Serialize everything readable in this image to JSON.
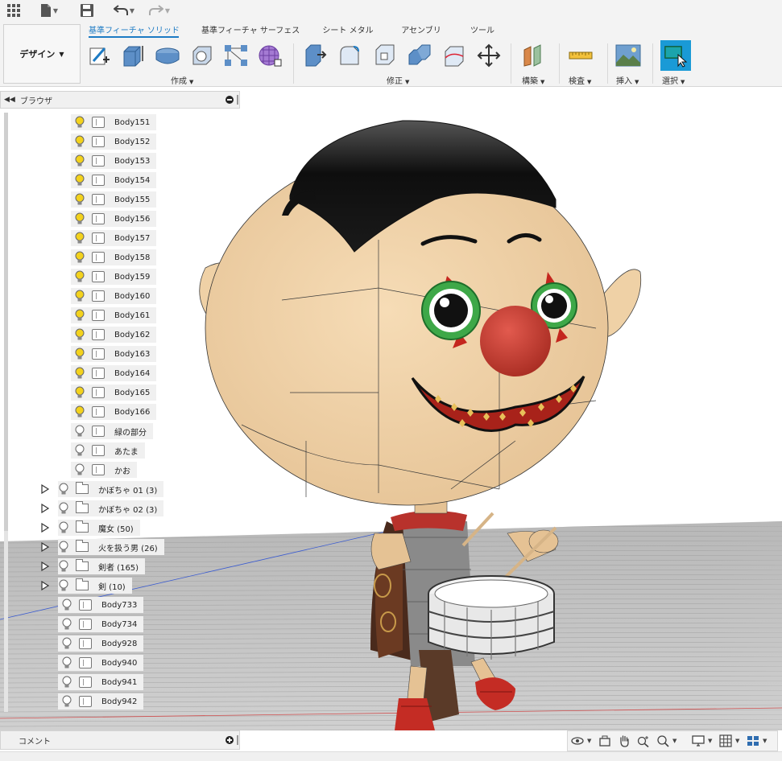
{
  "quickbar": {
    "items": [
      "apps-grid-icon",
      "file-icon",
      "save-icon",
      "undo-icon",
      "redo-icon"
    ]
  },
  "workspace": {
    "label": "デザイン"
  },
  "tabs": [
    {
      "label": "基準フィーチャ ソリッド",
      "active": true
    },
    {
      "label": "基準フィーチャ サーフェス",
      "active": false
    },
    {
      "label": "シート メタル",
      "active": false
    },
    {
      "label": "アセンブリ",
      "active": false
    },
    {
      "label": "ツール",
      "active": false
    }
  ],
  "groups": {
    "create": "作成",
    "modify": "修正",
    "construct": "構築",
    "inspect": "検査",
    "insert": "挿入",
    "select": "選択"
  },
  "browser": {
    "title": "ブラウザ",
    "items": [
      {
        "label": "Body151",
        "type": "body",
        "bulb": "on"
      },
      {
        "label": "Body152",
        "type": "body",
        "bulb": "on"
      },
      {
        "label": "Body153",
        "type": "body",
        "bulb": "on"
      },
      {
        "label": "Body154",
        "type": "body",
        "bulb": "on"
      },
      {
        "label": "Body155",
        "type": "body",
        "bulb": "on"
      },
      {
        "label": "Body156",
        "type": "body",
        "bulb": "on"
      },
      {
        "label": "Body157",
        "type": "body",
        "bulb": "on"
      },
      {
        "label": "Body158",
        "type": "body",
        "bulb": "on"
      },
      {
        "label": "Body159",
        "type": "body",
        "bulb": "on"
      },
      {
        "label": "Body160",
        "type": "body",
        "bulb": "on"
      },
      {
        "label": "Body161",
        "type": "body",
        "bulb": "on"
      },
      {
        "label": "Body162",
        "type": "body",
        "bulb": "on"
      },
      {
        "label": "Body163",
        "type": "body",
        "bulb": "on"
      },
      {
        "label": "Body164",
        "type": "body",
        "bulb": "on"
      },
      {
        "label": "Body165",
        "type": "body",
        "bulb": "on"
      },
      {
        "label": "Body166",
        "type": "body",
        "bulb": "on"
      },
      {
        "label": "緑の部分",
        "type": "body",
        "bulb": "off"
      },
      {
        "label": "あたま",
        "type": "body",
        "bulb": "off"
      },
      {
        "label": "かお",
        "type": "body",
        "bulb": "off"
      },
      {
        "label": "かぼちゃ 01 (3)",
        "type": "folder",
        "bulb": "off"
      },
      {
        "label": "かぼちゃ 02 (3)",
        "type": "folder",
        "bulb": "off"
      },
      {
        "label": "魔女 (50)",
        "type": "folder",
        "bulb": "off"
      },
      {
        "label": "火を扱う男 (26)",
        "type": "folder",
        "bulb": "off"
      },
      {
        "label": "剣者 (165)",
        "type": "folder",
        "bulb": "off"
      },
      {
        "label": "剣 (10)",
        "type": "folder",
        "bulb": "off"
      },
      {
        "label": "Body733",
        "type": "body2",
        "bulb": "off"
      },
      {
        "label": "Body734",
        "type": "body2",
        "bulb": "off"
      },
      {
        "label": "Body928",
        "type": "body2",
        "bulb": "off"
      },
      {
        "label": "Body940",
        "type": "body2",
        "bulb": "off"
      },
      {
        "label": "Body941",
        "type": "body2",
        "bulb": "off"
      },
      {
        "label": "Body942",
        "type": "body2",
        "bulb": "off"
      }
    ]
  },
  "comments": {
    "title": "コメント"
  },
  "colors": {
    "accent": "#1d7bc4",
    "bulb_on": "#f3d21c",
    "select_tool": "#1a9ad6"
  }
}
